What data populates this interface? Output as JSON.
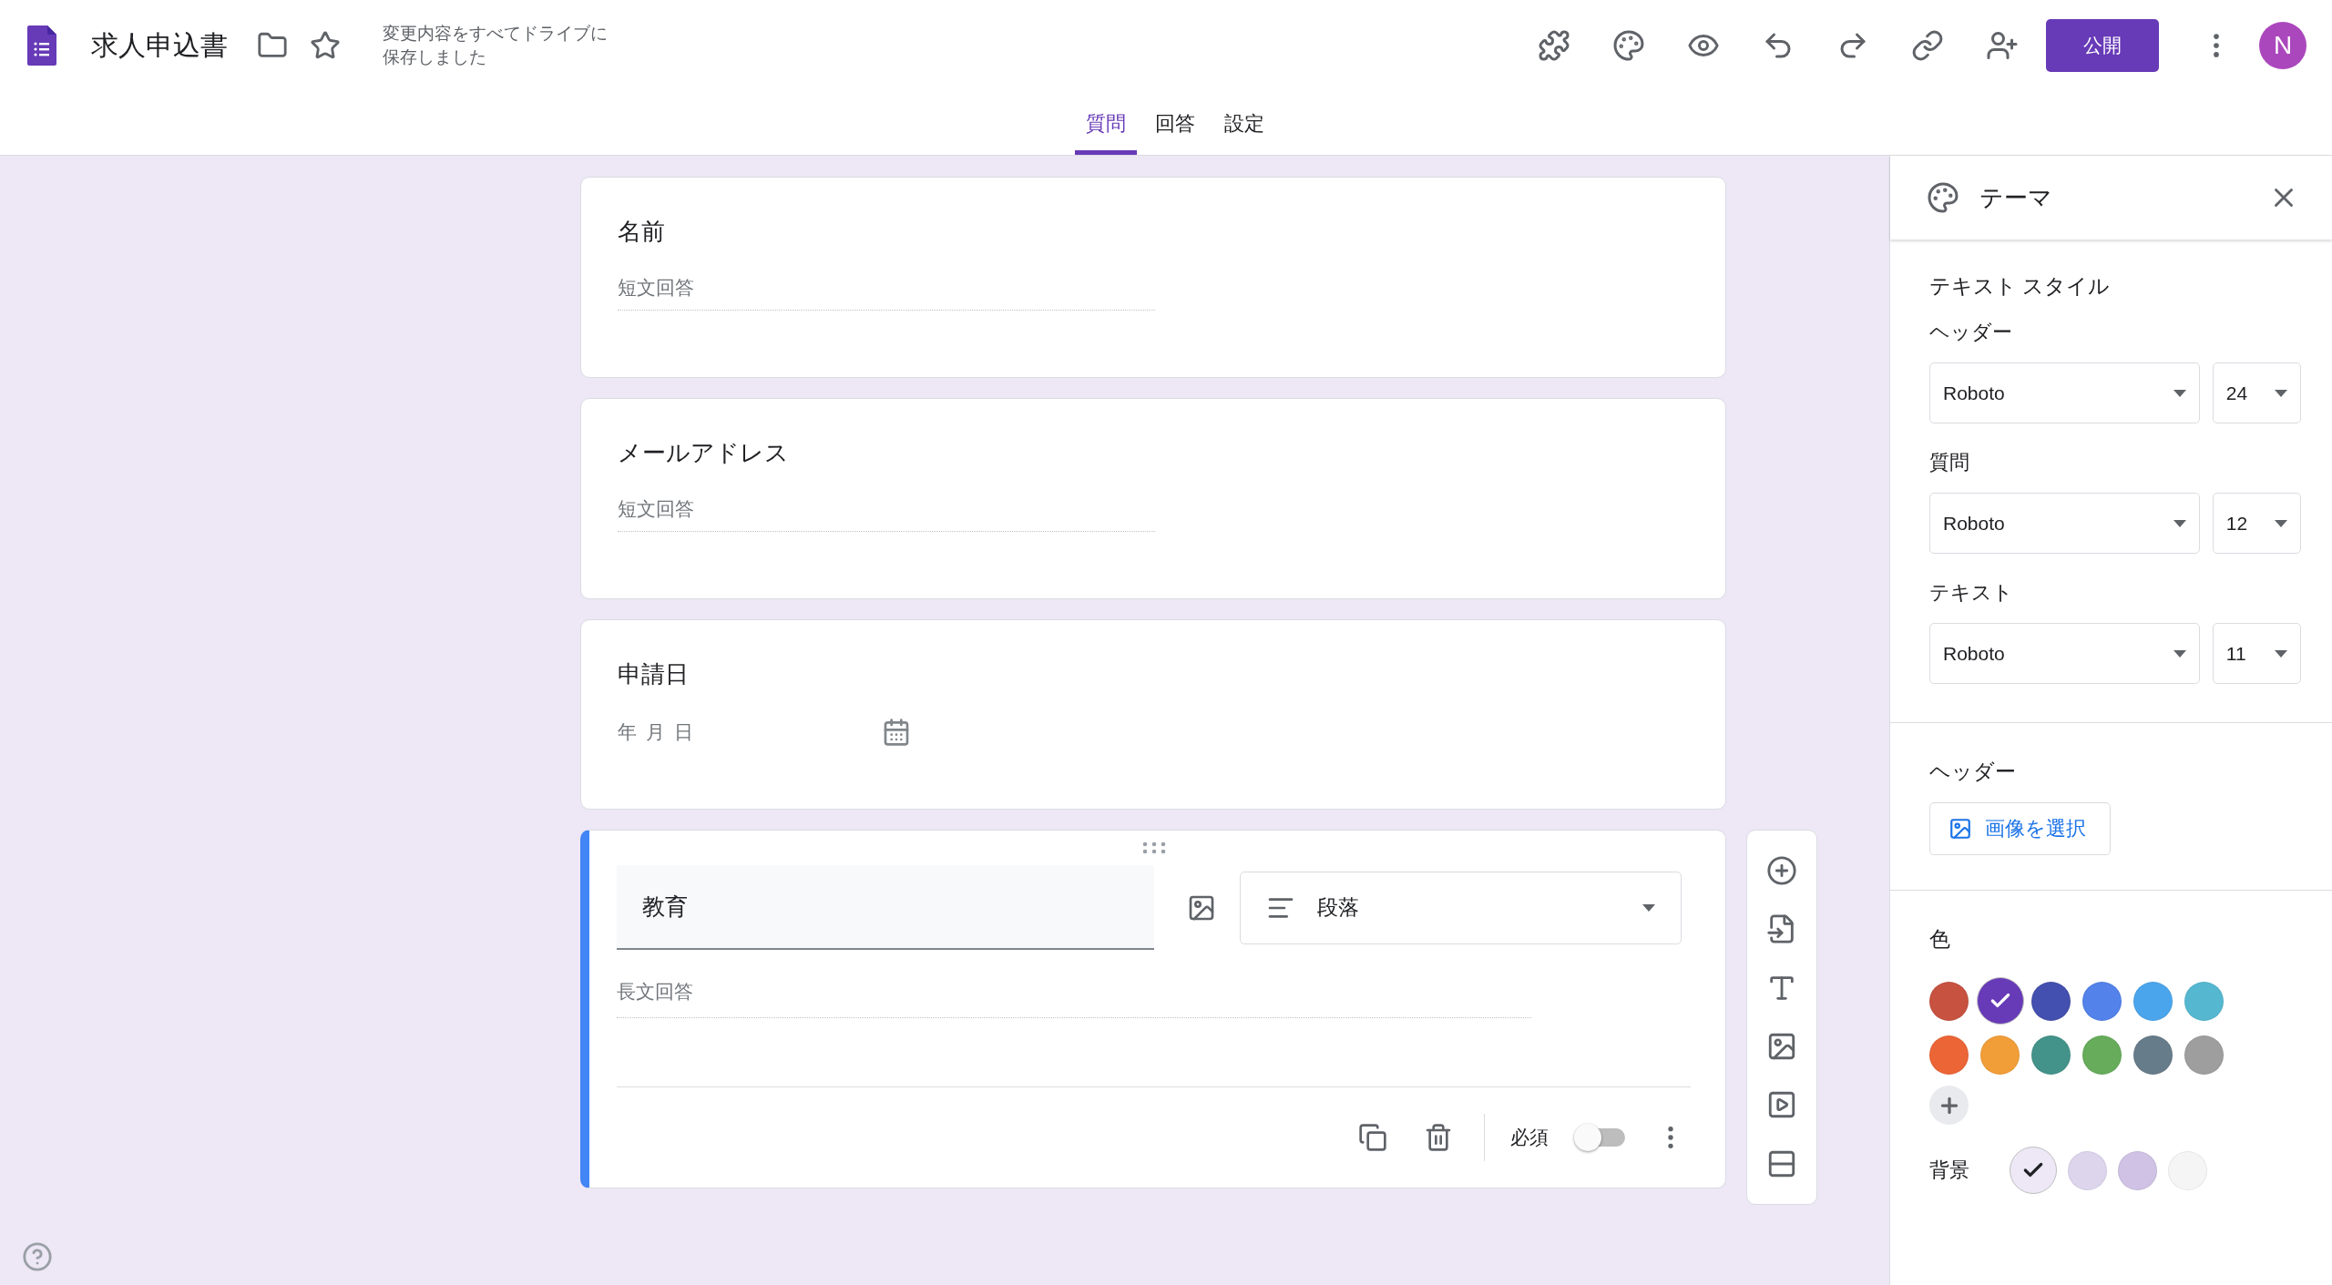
{
  "header": {
    "title": "求人申込書",
    "save_status": "変更内容をすべてドライブに保存しました",
    "publish_button": "公開",
    "avatar": "N"
  },
  "tabs": [
    {
      "label": "質問",
      "selected": true
    },
    {
      "label": "回答",
      "selected": false
    },
    {
      "label": "設定",
      "selected": false
    }
  ],
  "questions": [
    {
      "kind": "short",
      "title": "名前",
      "answer_hint": "短文回答"
    },
    {
      "kind": "short",
      "title": "メールアドレス",
      "answer_hint": "短文回答"
    },
    {
      "kind": "date",
      "title": "申請日",
      "answer_hint": "年 月 日"
    },
    {
      "kind": "editing",
      "title": "教育",
      "type": "段落",
      "answer_hint": "長文回答",
      "required_label": "必須",
      "required": false
    }
  ],
  "theme_panel": {
    "title": "テーマ",
    "text_style_heading": "テキスト スタイル",
    "styles": [
      {
        "label": "ヘッダー",
        "font": "Roboto",
        "size": "24"
      },
      {
        "label": "質問",
        "font": "Roboto",
        "size": "12"
      },
      {
        "label": "テキスト",
        "font": "Roboto",
        "size": "11"
      }
    ],
    "header_heading": "ヘッダー",
    "image_button": "画像を選択",
    "color_heading": "色",
    "colors": [
      {
        "color": "#c75240",
        "selected": false
      },
      {
        "color": "#673ab7",
        "selected": true
      },
      {
        "color": "#4350af",
        "selected": false
      },
      {
        "color": "#5282ea",
        "selected": false
      },
      {
        "color": "#4aa5ec",
        "selected": false
      },
      {
        "color": "#55b8d0",
        "selected": false
      },
      {
        "color": "#ec6536",
        "selected": false
      },
      {
        "color": "#f19e38",
        "selected": false
      },
      {
        "color": "#43938a",
        "selected": false
      },
      {
        "color": "#66ac5b",
        "selected": false
      },
      {
        "color": "#677c8a",
        "selected": false
      },
      {
        "color": "#9e9e9e",
        "selected": false
      }
    ],
    "background_label": "背景",
    "backgrounds": [
      {
        "color": "#ede7f6",
        "selected": true
      },
      {
        "color": "#dcd5ec",
        "selected": false
      },
      {
        "color": "#cfc2e4",
        "selected": false
      },
      {
        "color": "#f5f5f5",
        "selected": false
      }
    ]
  }
}
